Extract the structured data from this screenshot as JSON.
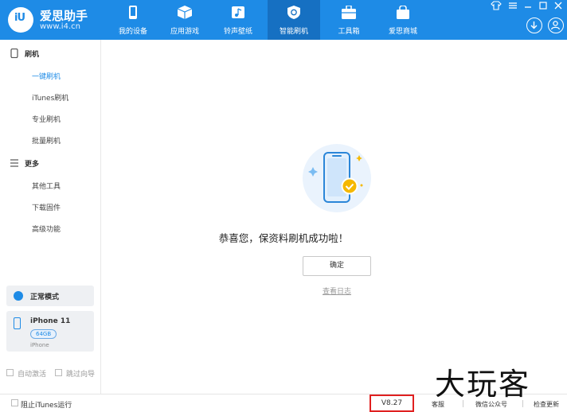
{
  "app": {
    "logo_text": "iU",
    "name": "爱思助手",
    "url": "www.i4.cn"
  },
  "nav": [
    {
      "label": "我的设备",
      "icon": "apple-icon"
    },
    {
      "label": "应用游戏",
      "icon": "box-icon"
    },
    {
      "label": "铃声壁纸",
      "icon": "music-folder-icon"
    },
    {
      "label": "智能刷机",
      "icon": "refresh-shield-icon",
      "active": true
    },
    {
      "label": "工具箱",
      "icon": "toolbox-icon"
    },
    {
      "label": "爱思商城",
      "icon": "shopping-bag-icon"
    }
  ],
  "sidebar": {
    "section1": "刷机",
    "flash_items": [
      "一键刷机",
      "iTunes刷机",
      "专业刷机",
      "批量刷机"
    ],
    "section2": "更多",
    "more_items": [
      "其他工具",
      "下载固件",
      "高级功能"
    ],
    "mode": "正常模式",
    "device": {
      "name": "iPhone 11",
      "capacity": "64GB",
      "model": "iPhone"
    },
    "auto_activate": "自动激活",
    "skip_guide": "跳过向导"
  },
  "main": {
    "message": "恭喜您，保资料刷机成功啦！",
    "ok_button": "确定",
    "log_link": "查看日志"
  },
  "bottom": {
    "itunes_block": "阻止iTunes运行",
    "version": "V8.27",
    "support": "客服",
    "wechat": "微信公众号",
    "update": "检查更新"
  },
  "watermark": "大玩客",
  "colors": {
    "brand": "#1e8be6",
    "active_nav": "#1670c2",
    "highlight_box": "#e02020",
    "check_badge": "#f5b800"
  }
}
